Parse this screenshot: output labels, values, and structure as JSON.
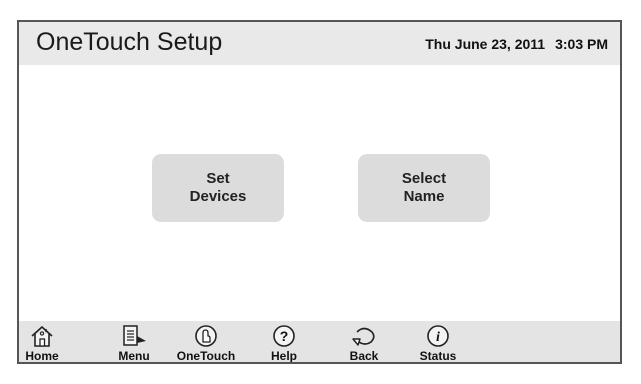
{
  "header": {
    "title": "OneTouch Setup",
    "date": "Thu June 23, 2011",
    "time": "3:03 PM"
  },
  "main": {
    "buttons": [
      {
        "line1": "Set",
        "line2": "Devices"
      },
      {
        "line1": "Select",
        "line2": "Name"
      }
    ]
  },
  "toolbar": {
    "items": [
      {
        "label": "Home",
        "icon": "home-icon"
      },
      {
        "label": "Menu",
        "icon": "menu-icon"
      },
      {
        "label": "OneTouch",
        "icon": "onetouch-icon"
      },
      {
        "label": "Help",
        "icon": "help-icon"
      },
      {
        "label": "Back",
        "icon": "back-icon"
      },
      {
        "label": "Status",
        "icon": "status-icon"
      }
    ]
  },
  "colors": {
    "header_bg": "#e9e9e9",
    "button_bg": "#dcdcdc",
    "toolbar_bg": "#e4e4e4",
    "border": "#555555"
  }
}
